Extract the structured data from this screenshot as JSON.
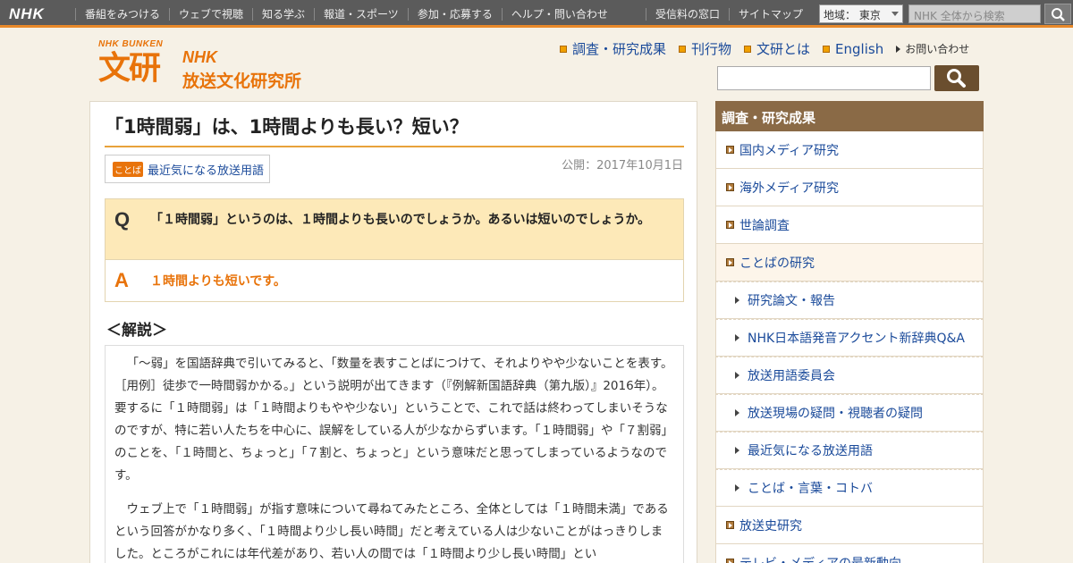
{
  "global_bar": {
    "logo": "NHK",
    "nav": [
      "番組をみつける",
      "ウェブで視聴",
      "知る学ぶ",
      "報道・スポーツ",
      "参加・応募する",
      "ヘルプ・問い合わせ"
    ],
    "right_links": [
      "受信料の窓口",
      "サイトマップ"
    ],
    "region": "地域： 東京",
    "search_placeholder": "NHK 全体から検索"
  },
  "site": {
    "mark_small": "NHK BUNKEN",
    "mark_big": "文研",
    "mark_nhk": "NHK",
    "mark_name": "放送文化研究所",
    "top_nav": [
      "調査・研究成果",
      "刊行物",
      "文研とは",
      "English"
    ],
    "contact": "お問い合わせ",
    "search_value": ""
  },
  "article": {
    "title": "「1時間弱」は、1時間よりも長い？短い？",
    "tag_label": "ことば",
    "tag_text": "最近気になる放送用語",
    "date": "公開：2017年10月1日",
    "q_label": "Q",
    "question": "「１時間弱」というのは、１時間よりも長いのでしょうか。あるいは短いのでしょうか。",
    "a_label": "A",
    "answer": "１時間よりも短いです。",
    "section_heading": "＜解説＞",
    "paragraphs": [
      "「～弱」を国語辞典で引いてみると、「数量を表すことばにつけて、それよりやや少ないことを表す。［用例］徒歩で一時間弱かかる。」という説明が出てきます（『例解新国語辞典（第九版）』2016年）。要するに「１時間弱」は「１時間よりもやや少ない」ということで、これで話は終わってしまいそうなのですが、特に若い人たちを中心に、誤解をしている人が少なからずいます。「１時間弱」や「７割弱」のことを、「１時間と、ちょっと」「７割と、ちょっと」という意味だと思ってしまっているようなのです。",
      "ウェブ上で「１時間弱」が指す意味について尋ねてみたところ、全体としては「１時間未満」であるという回答がかなり多く、「１時間より少し長い時間」だと考えている人は少ないことがはっきりしました。ところがこれには年代差があり、若い人の間では「１時間より少し長い時間」とい"
    ]
  },
  "sidebar": {
    "heading": "調査・研究成果",
    "items": [
      {
        "label": "国内メディア研究",
        "level": 1
      },
      {
        "label": "海外メディア研究",
        "level": 1
      },
      {
        "label": "世論調査",
        "level": 1
      },
      {
        "label": "ことばの研究",
        "level": 1,
        "selected": true
      },
      {
        "label": "研究論文・報告",
        "level": 2
      },
      {
        "label": "NHK日本語発音アクセント新辞典Q&A",
        "level": 2
      },
      {
        "label": "放送用語委員会",
        "level": 2
      },
      {
        "label": "放送現場の疑問・視聴者の疑問",
        "level": 2
      },
      {
        "label": "最近気になる放送用語",
        "level": 2
      },
      {
        "label": "ことば・言葉・コトバ",
        "level": 2
      },
      {
        "label": "放送史研究",
        "level": 1
      },
      {
        "label": "テレビ・メディアの最新動向",
        "level": 1
      }
    ]
  },
  "colors": {
    "accent": "#e8730a",
    "sidebar_head": "#8a6a46",
    "link": "#1a4a9a"
  }
}
